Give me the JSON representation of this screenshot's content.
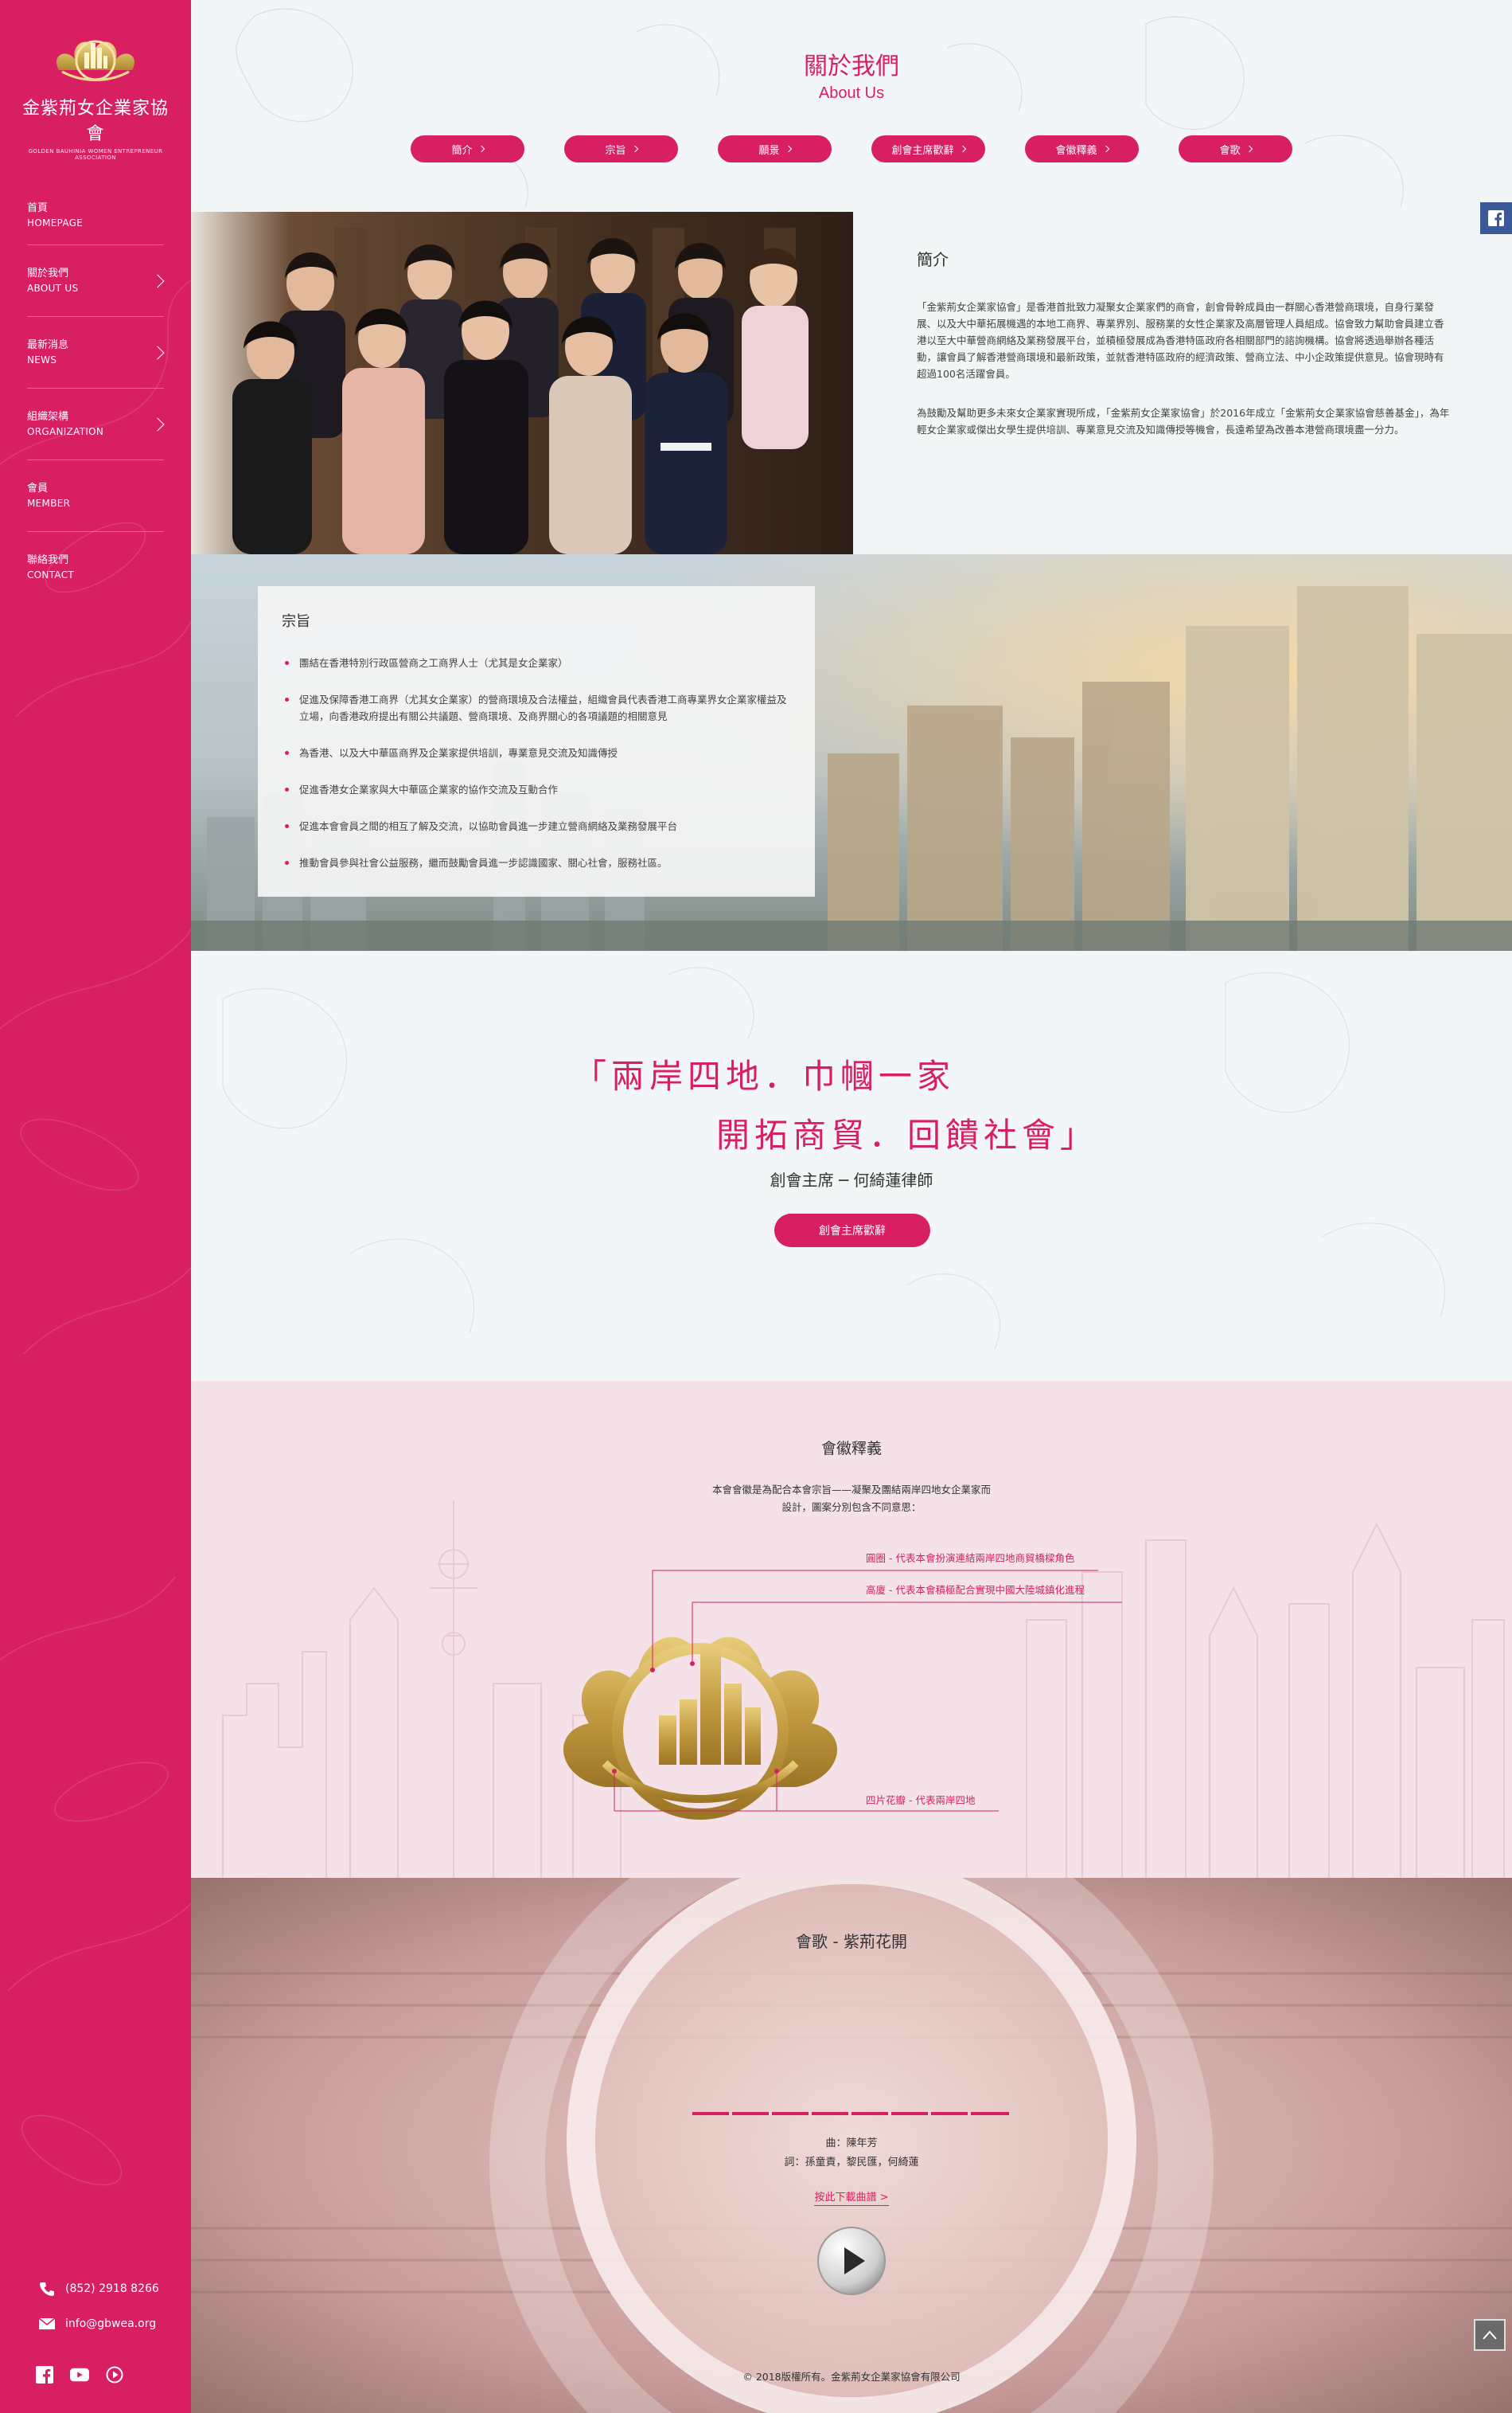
{
  "org": {
    "name_cn": "金紫荊女企業家協會",
    "name_en": "GOLDEN BAUHINIA WOMEN ENTREPRENEUR ASSOCIATION"
  },
  "nav": [
    {
      "cn": "首頁",
      "en": "HOMEPAGE",
      "has_sub": false
    },
    {
      "cn": "關於我們",
      "en": "ABOUT US",
      "has_sub": true
    },
    {
      "cn": "最新消息",
      "en": "NEWS",
      "has_sub": true
    },
    {
      "cn": "組織架構",
      "en": "ORGANIZATION",
      "has_sub": true
    },
    {
      "cn": "會員",
      "en": "MEMBER",
      "has_sub": false
    },
    {
      "cn": "聯絡我們",
      "en": "CONTACT",
      "has_sub": false
    }
  ],
  "contact": {
    "phone": "(852) 2918 8266",
    "email": "info@gbwea.org"
  },
  "header": {
    "title_cn": "關於我們",
    "title_en": "About Us"
  },
  "tabs": [
    "簡介",
    "宗旨",
    "願景",
    "創會主席歡辭",
    "會徽釋義",
    "會歌"
  ],
  "intro": {
    "heading": "簡介",
    "p1": "「金紫荊女企業家協會」是香港首批致力凝聚女企業家們的商會，創會骨幹成員由一群關心香港營商環境，自身行業發展、以及大中華拓展機遇的本地工商界、專業界別、服務業的女性企業家及高層管理人員組成。協會致力幫助會員建立香港以至大中華營商網絡及業務發展平台，並積極發展成為香港特區政府各相關部門的諮詢機構。協會將透過舉辦各種活動，讓會員了解香港營商環境和最新政策，並就香港特區政府的經濟政策、營商立法、中小企政策提供意見。協會現時有超過100名活躍會員。",
    "p2": "為鼓勵及幫助更多未來女企業家實現所成，「金紫荊女企業家協會」於2016年成立「金紫荊女企業家協會慈善基金」，為年輕女企業家或傑出女學生提供培訓、專業意見交流及知識傳授等機會，長遠希望為改善本港營商環境盡一分力。"
  },
  "mission": {
    "heading": "宗旨",
    "items": [
      "團結在香港特別行政區營商之工商界人士（尤其是女企業家）",
      "促進及保障香港工商界（尤其女企業家）的營商環境及合法權益，組織會員代表香港工商專業界女企業家權益及立場，向香港政府提出有關公共議題、營商環境、及商界關心的各項議題的相關意見",
      "為香港、以及大中華區商界及企業家提供培訓，專業意見交流及知識傳授",
      "促進香港女企業家與大中華區企業家的協作交流及互動合作",
      "促進本會會員之間的相互了解及交流，以協助會員進一步建立營商網絡及業務發展平台",
      "推動會員參與社會公益服務，繼而鼓勵會員進一步認識國家、關心社會，服務社區。"
    ]
  },
  "motto": {
    "line1": "「兩岸四地．巾幗一家",
    "line2": "開拓商貿．回饋社會」",
    "by": "創會主席 ─ 何綺蓮律師",
    "button": "創會主席歡辭"
  },
  "emblem": {
    "heading": "會徽釋義",
    "desc1": "本會會徽是為配合本會宗旨——凝聚及團結兩岸四地女企業家而",
    "desc2": "設計，圖案分別包含不同意思：",
    "label1": "圓圈 - 代表本會扮演連結兩岸四地商貿橋樑角色",
    "label2": "高廈 - 代表本會積極配合實現中國大陸城鎮化進程",
    "label3": "四片花瓣 - 代表兩岸四地"
  },
  "anthem": {
    "heading": "會歌 - 紫荊花開",
    "composer": "曲：陳年芳",
    "lyricist": "詞：孫童責，黎民匯，何綺蓮",
    "download": "按此下載曲譜 >"
  },
  "footer": {
    "copyright": "© 2018版權所有。金紫荊女企業家協會有限公司"
  },
  "colors": {
    "brand": "#d81f62",
    "gold": "#b8943a",
    "emblem_bg": "#f4e2e8"
  }
}
